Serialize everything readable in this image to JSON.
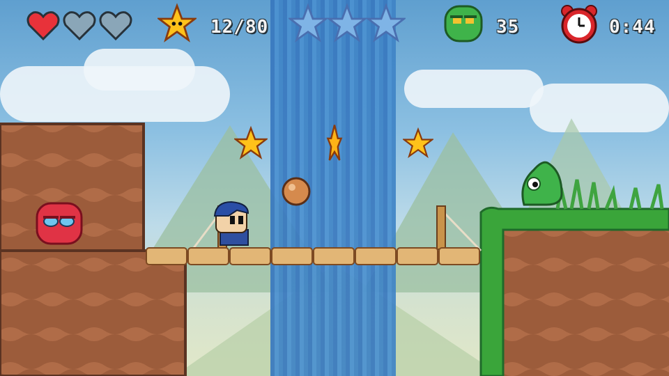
{
  "hud": {
    "hearts": {
      "full": 1,
      "total": 3
    },
    "stars_collected": "12/80",
    "big_stars": {
      "collected": 0,
      "total": 3
    },
    "enemy_count": "35",
    "timer": "0:44"
  },
  "icons": {
    "heart": "heart-icon",
    "star": "star-icon",
    "enemy": "slime-icon",
    "timer": "alarm-clock-icon"
  },
  "colors": {
    "heart_full": "#e8323a",
    "heart_empty": "#8aa6b8",
    "star_gold": "#ffc21a",
    "star_outline": "#8a3b0d",
    "big_star_empty": "#7fb4e6",
    "slime_green": "#3fb34a",
    "clock_red": "#d9262b",
    "waterfall": "#3f86c8",
    "dirt": "#9c5c3b",
    "grass": "#3aa53a"
  }
}
